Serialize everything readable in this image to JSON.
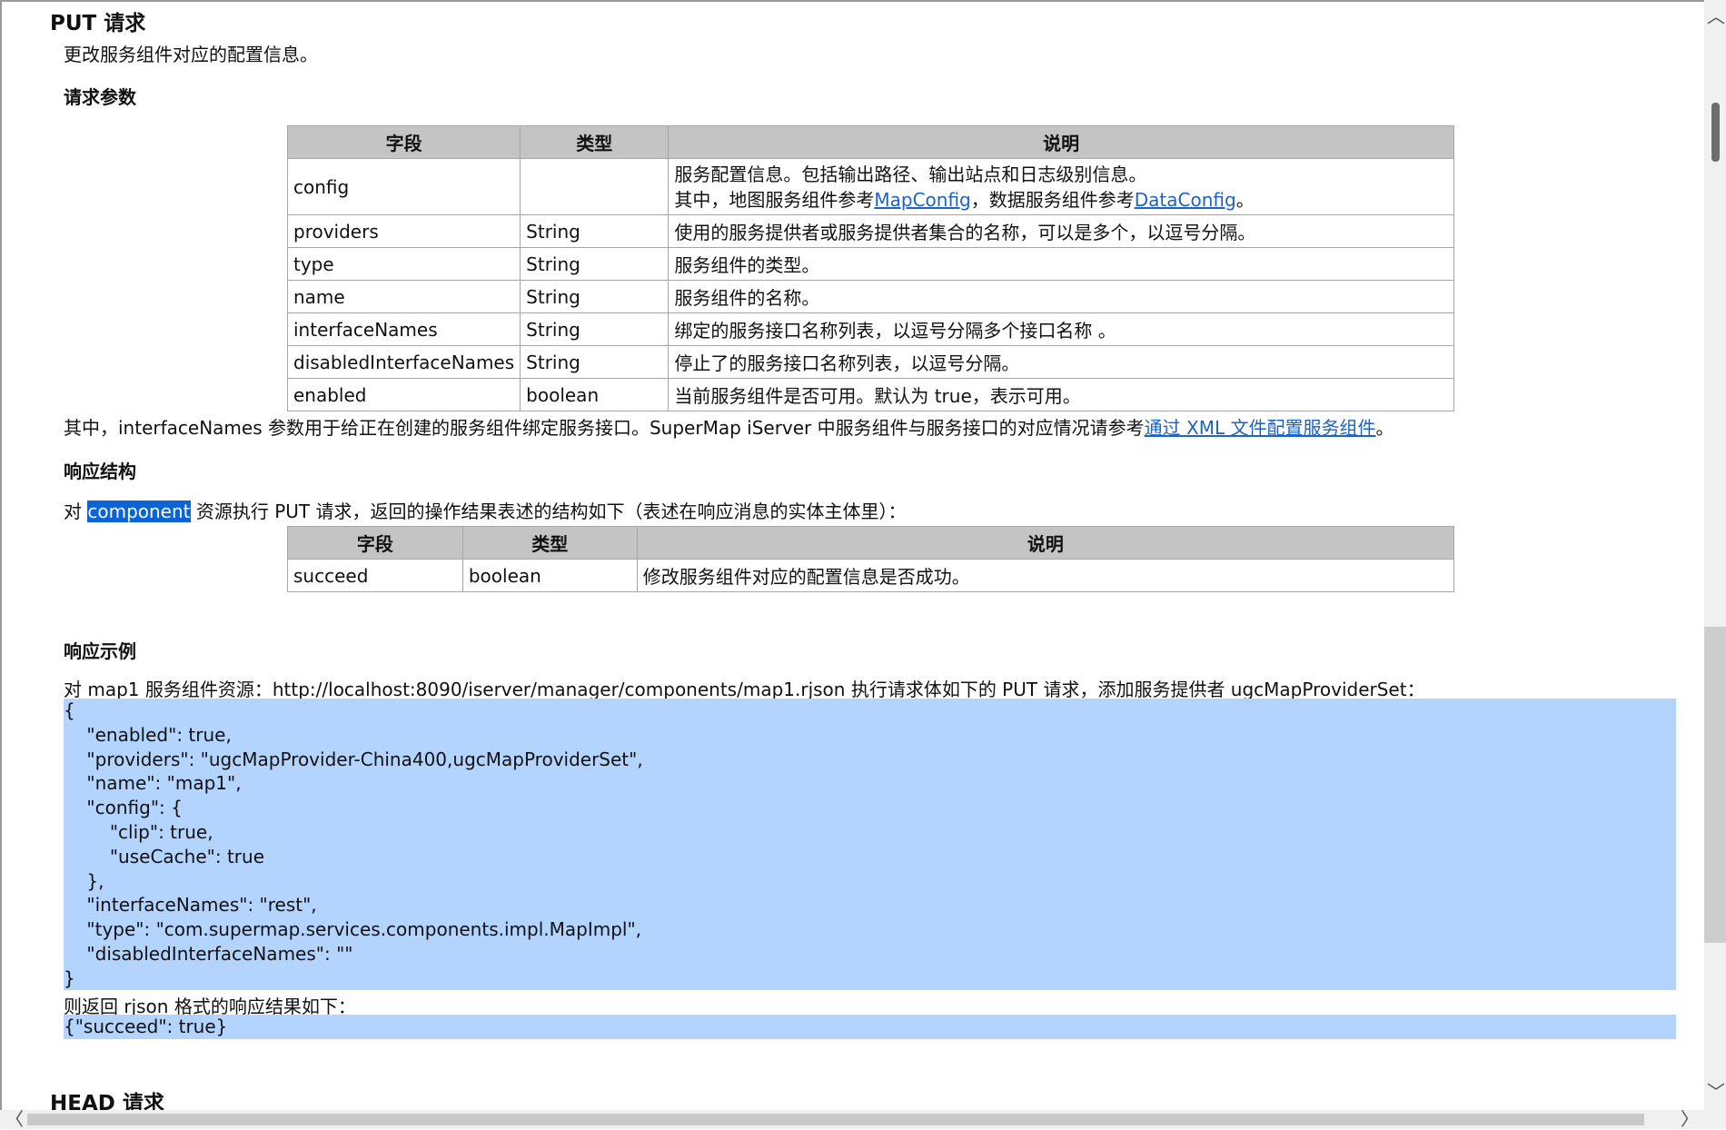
{
  "put_section": {
    "title": "PUT 请求",
    "description": "更改服务组件对应的配置信息。",
    "request_params_heading": "请求参数",
    "request_table": {
      "headers": [
        "字段",
        "类型",
        "说明"
      ],
      "rows": [
        {
          "field": "config",
          "type": "",
          "desc_line1": "服务配置信息。包括输出路径、输出站点和日志级别信息。",
          "desc_line2_pre": "其中，地图服务组件参考",
          "link1": "MapConfig",
          "desc_line2_mid": "，数据服务组件参考",
          "link2": "DataConfig",
          "desc_line2_post": "。"
        },
        {
          "field": "providers",
          "type": "String",
          "desc": "使用的服务提供者或服务提供者集合的名称，可以是多个，以逗号分隔。"
        },
        {
          "field": "type",
          "type": "String",
          "desc": "服务组件的类型。"
        },
        {
          "field": "name",
          "type": "String",
          "desc": "服务组件的名称。"
        },
        {
          "field": "interfaceNames",
          "type": "String",
          "desc": "绑定的服务接口名称列表，以逗号分隔多个接口名称 。"
        },
        {
          "field": "disabledInterfaceNames",
          "type": "String",
          "desc": "停止了的服务接口名称列表，以逗号分隔。"
        },
        {
          "field": "enabled",
          "type": "boolean",
          "desc": "当前服务组件是否可用。默认为 true，表示可用。"
        }
      ]
    },
    "note_pre": "其中，interfaceNames 参数用于给正在创建的服务组件绑定服务接口。SuperMap iServer 中服务组件与服务接口的对应情况请参考",
    "note_link": "通过 XML 文件配置服务组件",
    "note_post": "。",
    "response_structure_heading": "响应结构",
    "response_intro_pre": "对 ",
    "response_intro_selected": "component",
    "response_intro_post": " 资源执行 PUT 请求，返回的操作结果表述的结构如下（表述在响应消息的实体主体里）：",
    "response_table": {
      "headers": [
        "字段",
        "类型",
        "说明"
      ],
      "rows": [
        {
          "field": "succeed",
          "type": "boolean",
          "desc": "修改服务组件对应的配置信息是否成功。"
        }
      ]
    },
    "response_example_heading": "响应示例",
    "example_intro": "对 map1 服务组件资源：http://localhost:8090/iserver/manager/components/map1.rjson 执行请求体如下的 PUT 请求，添加服务提供者 ugcMapProviderSet：",
    "request_body_lines": [
      "{",
      "    \"enabled\": true,",
      "    \"providers\": \"ugcMapProvider-China400,ugcMapProviderSet\",",
      "    \"name\": \"map1\",",
      "    \"config\": {",
      "        \"clip\": true,",
      "        \"useCache\": true",
      "    },",
      "    \"interfaceNames\": \"rest\",",
      "    \"type\": \"com.supermap.services.components.impl.MapImpl\",",
      "    \"disabledInterfaceNames\": \"\"",
      "}"
    ],
    "result_intro": "则返回 rjson 格式的响应结果如下：",
    "result_body": "{\"succeed\": true}"
  },
  "head_section": {
    "title": "HEAD 请求"
  },
  "scrollbar": {
    "up_arrow": "︿",
    "down_arrow": "﹀",
    "left_arrow": "〈",
    "right_arrow": "〉"
  }
}
